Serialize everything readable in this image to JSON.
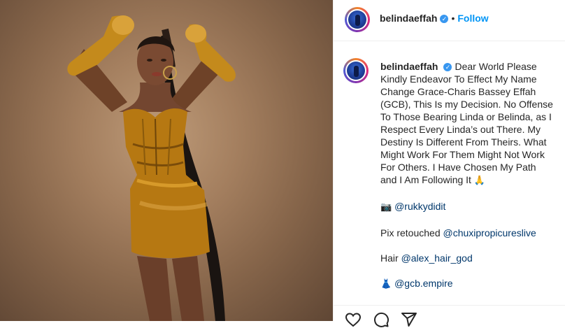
{
  "post": {
    "username": "belindaeffah",
    "dot": "•",
    "follow_label": "Follow",
    "verified_glyph": "✓",
    "caption": {
      "text": "Dear World Please Kindly Endeavor To Effect My Name Change Grace-Charis Bassey Effah (GCB), This Is my Decision. No Offense To Those Bearing Linda or Belinda, as I Respect Every Linda’s out There. My Destiny Is Different From Theirs. What Might Work For Them Might Not Work For Others. I Have Chosen My Path and I Am Following It",
      "text_emoji": "🙏",
      "photo_emoji": "📷",
      "photo_mention": "@rukkydidit",
      "retouch_text": "Pix retouched",
      "retouch_mention": "@chuxipropicureslive",
      "hair_text": "Hair",
      "hair_mention": "@alex_hair_god",
      "dress_emoji": "👗",
      "dress_mention": "@gcb.empire"
    }
  },
  "icons": {
    "header_avatar": "profile-avatar",
    "verified": "verified-badge-icon",
    "like": "heart-icon",
    "comment": "comment-icon",
    "share": "share-icon"
  },
  "colors": {
    "link": "#0095f6",
    "mention": "#00376b",
    "verified": "#3897f0",
    "text": "#262626"
  }
}
